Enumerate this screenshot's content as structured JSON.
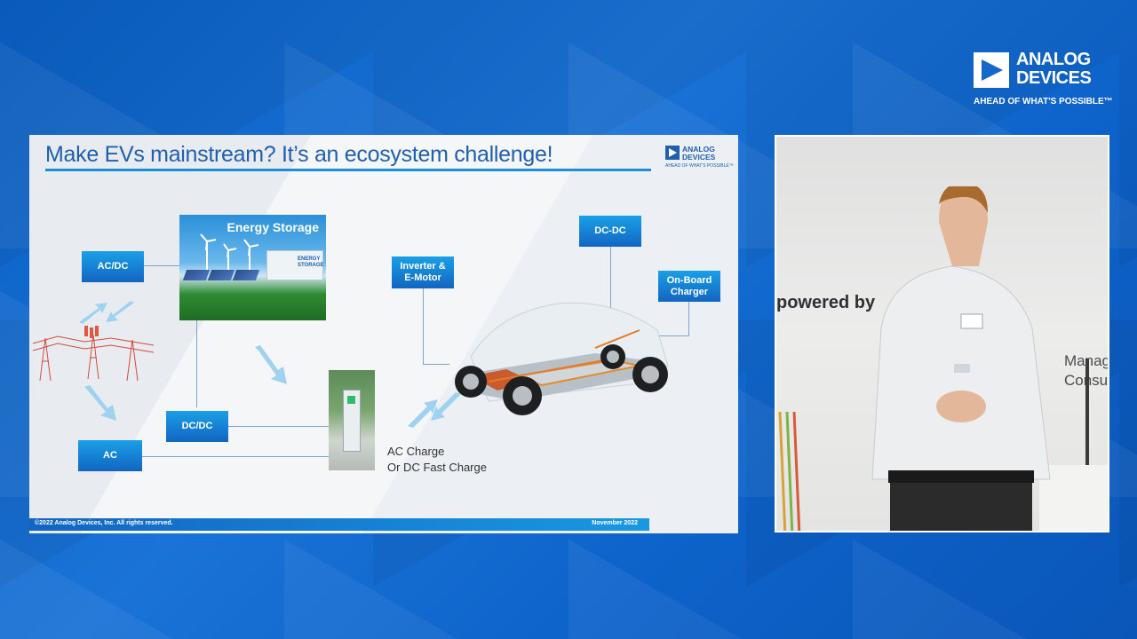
{
  "brand": {
    "line1": "ANALOG",
    "line2": "DEVICES",
    "tagline": "AHEAD OF WHAT'S POSSIBLE™"
  },
  "slide": {
    "title": "Make EVs mainstream? It’s an ecosystem challenge!",
    "logo": {
      "line1": "ANALOG",
      "line2": "DEVICES",
      "tagline": "AHEAD OF WHAT'S POSSIBLE™"
    },
    "boxes": {
      "acdc": "AC/DC",
      "dcdc_left": "DC/DC",
      "ac": "AC",
      "inverter_line1": "Inverter &",
      "inverter_line2": "E-Motor",
      "dcdc_car": "DC-DC",
      "onboard_line1": "On-Board",
      "onboard_line2": "Charger"
    },
    "energy_storage_title": "Energy Storage",
    "energy_storage_container_label": "ENERGY STORAGE",
    "charge_label_line1": "AC Charge",
    "charge_label_line2": "Or DC Fast Charge",
    "footer_left": "©2022 Analog Devices, Inc. All rights reserved.",
    "footer_right": "November 2022"
  },
  "video": {
    "backdrop_text_1": "powered by",
    "backdrop_text_2": "Manag\nConsu",
    "badge_logo": "ANALOG DEVICES"
  },
  "colors": {
    "background": "#1468cc",
    "slide_title": "#1f5fae",
    "box_gradient_top": "#1aa0e6",
    "box_gradient_bottom": "#1265c2",
    "accent_rule": "#1b8fd9"
  }
}
